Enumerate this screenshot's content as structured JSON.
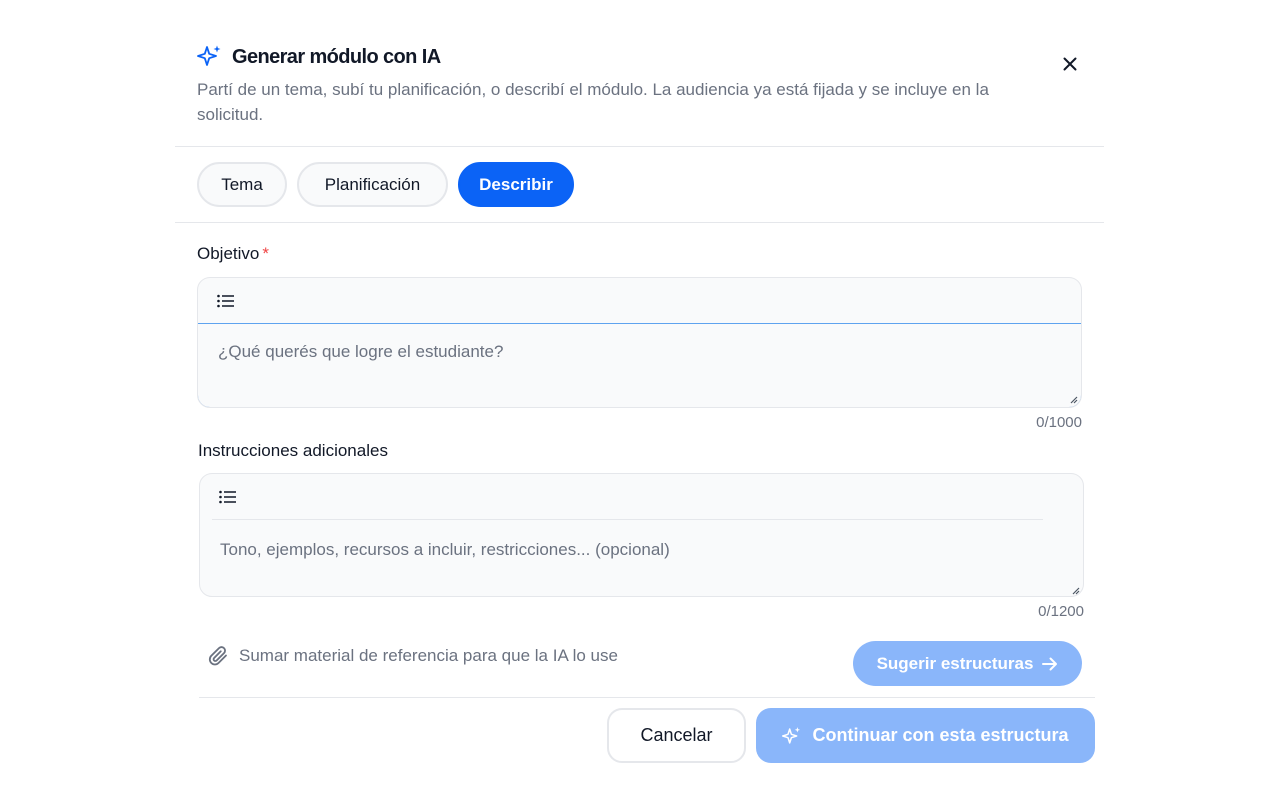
{
  "dialog": {
    "title": "Generar módulo con IA",
    "subtitle": "Partí de un tema, subí tu planificación, o describí el módulo. La audiencia ya está fijada y se incluye en la solicitud.",
    "title_icon": "sparkles-icon",
    "close_icon": "close-icon"
  },
  "tabs": [
    {
      "label": "Tema",
      "active": false
    },
    {
      "label": "Planificación",
      "active": false
    },
    {
      "label": "Describir",
      "active": true
    }
  ],
  "objective": {
    "label": "Objetivo",
    "required_mark": "*",
    "toolbar_icon": "list-icon",
    "placeholder": "¿Qué querés que logre el estudiante?",
    "counter": "0/1000"
  },
  "instructions": {
    "label": "Instrucciones adicionales",
    "toolbar_icon": "list-icon",
    "placeholder": "Tono, ejemplos, recursos a incluir, restricciones... (opcional)",
    "counter": "0/1200"
  },
  "attach": {
    "label": "Sumar material de referencia para que la IA lo use",
    "icon": "paperclip-icon"
  },
  "suggest_button": {
    "label": "Sugerir estructuras",
    "icon": "arrow-right-icon"
  },
  "footer": {
    "cancel_label": "Cancelar",
    "continue_label": "Continuar con esta estructura",
    "continue_icon": "sparkles-icon"
  },
  "colors": {
    "accent": "#0b63f6",
    "accent_disabled": "#8ab6fa",
    "required": "#ef4444",
    "muted_text": "#6b7280"
  }
}
